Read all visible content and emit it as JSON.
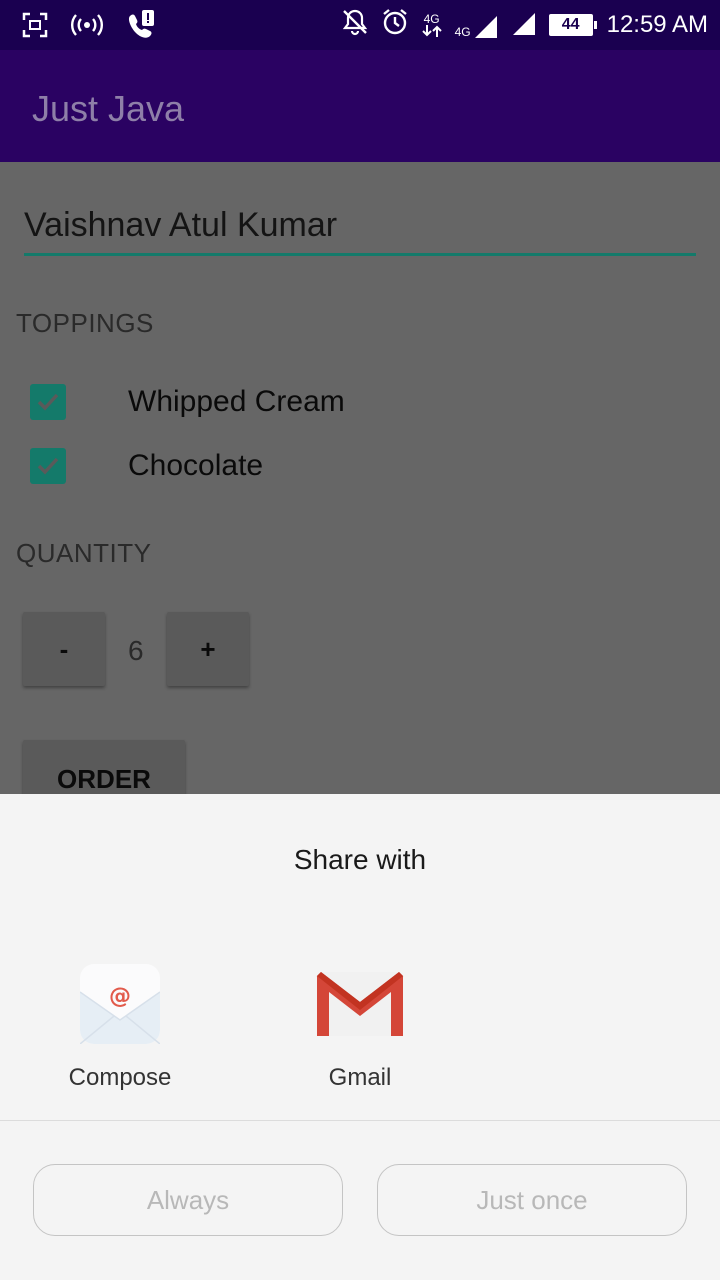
{
  "status_bar": {
    "time": "12:59 AM",
    "battery": "44",
    "network_label_a": "4G",
    "network_label_b": "4G",
    "icons": [
      "screenshot-icon",
      "hotspot-icon",
      "call-alert-icon",
      "notifications-off-icon",
      "alarm-icon",
      "data-arrows-icon",
      "signal-icon",
      "signal-icon",
      "battery-icon"
    ]
  },
  "app_bar": {
    "title": "Just Java"
  },
  "form": {
    "name_value": "Vaishnav Atul Kumar",
    "toppings_header": "TOPPINGS",
    "toppings": [
      {
        "label": "Whipped Cream",
        "checked": true
      },
      {
        "label": "Chocolate",
        "checked": true
      }
    ],
    "quantity_header": "QUANTITY",
    "decrement_label": "-",
    "quantity_value": "6",
    "increment_label": "+",
    "order_label": "ORDER"
  },
  "share_sheet": {
    "title": "Share with",
    "apps": [
      {
        "label": "Compose",
        "icon": "compose-email-icon"
      },
      {
        "label": "Gmail",
        "icon": "gmail-icon"
      }
    ],
    "always_label": "Always",
    "just_once_label": "Just once"
  },
  "colors": {
    "status_bar": "#1a0050",
    "app_bar": "#2a0262",
    "accent": "#147a6a",
    "scrim": "#666666",
    "sheet_bg": "#f4f4f4"
  }
}
